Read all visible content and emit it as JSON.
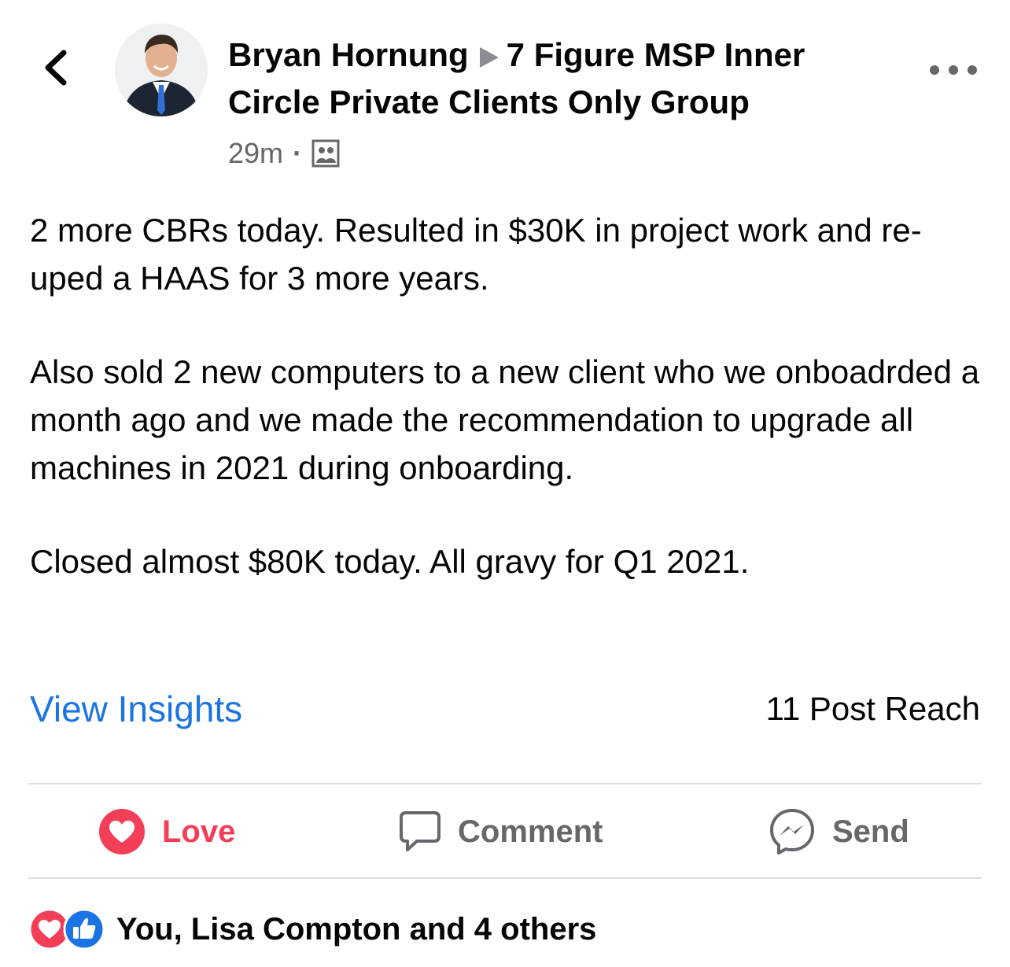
{
  "header": {
    "author": "Bryan Hornung",
    "group": "7 Figure MSP Inner Circle Private Clients Only Group",
    "timestamp": "29m",
    "separator": "·",
    "privacy_icon": "group-members-icon"
  },
  "post": {
    "paragraphs": [
      "2 more CBRs today.  Resulted in $30K in project work and re-uped a HAAS for 3 more years.",
      "Also sold 2 new computers to a new client who we onboadrded a month ago and we made the recommendation to upgrade all machines in 2021 during onboarding.",
      "Closed almost $80K today.  All gravy for Q1 2021."
    ]
  },
  "insights": {
    "link_label": "View Insights",
    "reach_label": "11 Post Reach"
  },
  "actions": {
    "love_label": "Love",
    "comment_label": "Comment",
    "send_label": "Send"
  },
  "reactions": {
    "summary": "You, Lisa Compton and 4 others"
  },
  "colors": {
    "link_blue": "#1b74e4",
    "love_red": "#f33e58",
    "secondary_gray": "#65676b",
    "divider": "#dadde1"
  }
}
